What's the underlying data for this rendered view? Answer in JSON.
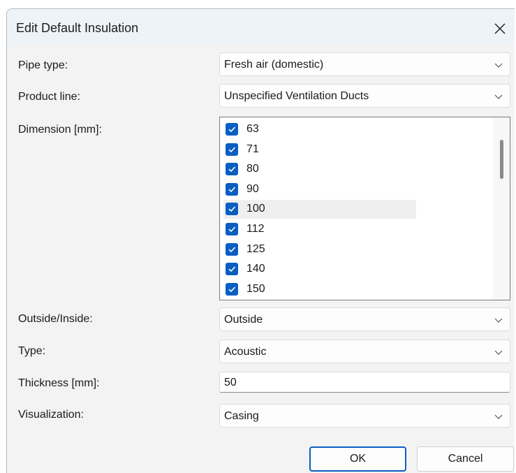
{
  "dialog": {
    "title": "Edit Default Insulation",
    "close_icon": "close-icon"
  },
  "fields": {
    "pipe_type": {
      "label": "Pipe type:",
      "value": "Fresh air (domestic)"
    },
    "product_line": {
      "label": "Product line:",
      "value": "Unspecified Ventilation Ducts"
    },
    "dimension": {
      "label": "Dimension [mm]:",
      "items": [
        {
          "label": "63",
          "checked": true
        },
        {
          "label": "71",
          "checked": true
        },
        {
          "label": "80",
          "checked": true
        },
        {
          "label": "90",
          "checked": true
        },
        {
          "label": "100",
          "checked": true,
          "highlighted": true
        },
        {
          "label": "112",
          "checked": true
        },
        {
          "label": "125",
          "checked": true
        },
        {
          "label": "140",
          "checked": true
        },
        {
          "label": "150",
          "checked": true
        }
      ]
    },
    "outside_inside": {
      "label": "Outside/Inside:",
      "value": "Outside"
    },
    "type": {
      "label": "Type:",
      "value": "Acoustic"
    },
    "thickness": {
      "label": "Thickness [mm]:",
      "value": "50"
    },
    "visualization": {
      "label": "Visualization:",
      "value": "Casing"
    }
  },
  "buttons": {
    "ok": "OK",
    "cancel": "Cancel"
  },
  "colors": {
    "accent": "#0a5ec2",
    "dialog_bg": "#f3f3f3",
    "titlebar_bg": "#eef3f8"
  }
}
